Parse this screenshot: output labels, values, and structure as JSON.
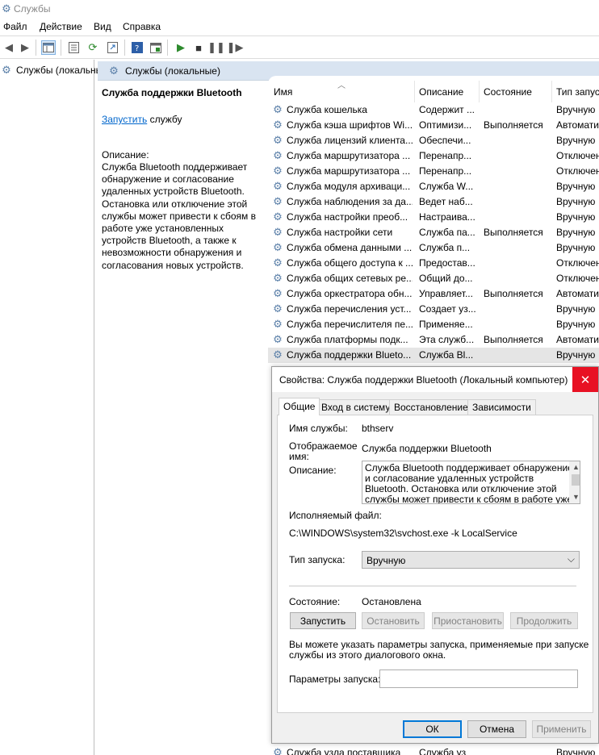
{
  "window": {
    "title": "Службы"
  },
  "menu": [
    "Файл",
    "Действие",
    "Вид",
    "Справка"
  ],
  "tree": {
    "item": "Службы (локальные)"
  },
  "pane": {
    "header": "Службы (локальные)"
  },
  "detail": {
    "service_title": "Служба поддержки Bluetooth",
    "start_link": "Запустить",
    "start_suffix": " службу",
    "description_label": "Описание:",
    "description_text": "Служба Bluetooth поддерживает обнаружение и согласование удаленных устройств Bluetooth. Остановка или отключение этой службы может привести к сбоям в работе уже установленных устройств Bluetooth, а также к невозможности обнаружения и согласования новых устройств."
  },
  "list": {
    "columns": [
      "Имя",
      "Описание",
      "Состояние",
      "Тип запуску"
    ],
    "rows": [
      {
        "name": "Служба кошелька",
        "desc": "Содержит ...",
        "state": "",
        "start": "Вручную"
      },
      {
        "name": "Служба кэша шрифтов Wi...",
        "desc": "Оптимизи...",
        "state": "Выполняется",
        "start": "Автомати"
      },
      {
        "name": "Служба лицензий клиента...",
        "desc": "Обеспечи...",
        "state": "",
        "start": "Вручную"
      },
      {
        "name": "Служба маршрутизатора ...",
        "desc": "Перенапр...",
        "state": "",
        "start": "Отключен"
      },
      {
        "name": "Служба маршрутизатора ...",
        "desc": "Перенапр...",
        "state": "",
        "start": "Отключен"
      },
      {
        "name": "Служба модуля архиваци...",
        "desc": "Служба W...",
        "state": "",
        "start": "Вручную"
      },
      {
        "name": "Служба наблюдения за да...",
        "desc": "Ведет наб...",
        "state": "",
        "start": "Вручную"
      },
      {
        "name": "Служба настройки преоб...",
        "desc": "Настраива...",
        "state": "",
        "start": "Вручную"
      },
      {
        "name": "Служба настройки сети",
        "desc": "Служба па...",
        "state": "Выполняется",
        "start": "Вручную"
      },
      {
        "name": "Служба обмена данными ...",
        "desc": "Служба п...",
        "state": "",
        "start": "Вручную"
      },
      {
        "name": "Служба общего доступа к ...",
        "desc": "Предостав...",
        "state": "",
        "start": "Отключен"
      },
      {
        "name": "Служба общих сетевых ре...",
        "desc": "Общий до...",
        "state": "",
        "start": "Отключен"
      },
      {
        "name": "Служба оркестратора обн...",
        "desc": "Управляет...",
        "state": "Выполняется",
        "start": "Автомати"
      },
      {
        "name": "Служба перечисления уст...",
        "desc": "Создает уз...",
        "state": "",
        "start": "Вручную"
      },
      {
        "name": "Служба перечислителя пе...",
        "desc": "Применяе...",
        "state": "",
        "start": "Вручную"
      },
      {
        "name": "Служба платформы подк...",
        "desc": "Эта служб...",
        "state": "Выполняется",
        "start": "Автомати"
      },
      {
        "name": "Служба поддержки Blueto...",
        "desc": "Служба Bl...",
        "state": "",
        "start": "Вручную"
      }
    ],
    "bottom_row": {
      "name": "Служба узла поставщика",
      "desc": "Служба уз",
      "start": "Вручную"
    }
  },
  "dialog": {
    "title": "Свойства: Служба поддержки Bluetooth (Локальный компьютер)",
    "close": "✕",
    "tabs": [
      "Общие",
      "Вход в систему",
      "Восстановление",
      "Зависимости"
    ],
    "service_name_label": "Имя службы:",
    "service_name": "bthserv",
    "display_name_label_1": "Отображаемое",
    "display_name_label_2": "имя:",
    "display_name": "Служба поддержки Bluetooth",
    "description_label": "Описание:",
    "description": "Служба Bluetooth поддерживает обнаружение и согласование удаленных устройств Bluetooth. Остановка или отключение этой службы может привести к сбоям в работе уже установленных",
    "exe_label": "Исполняемый файл:",
    "exe_path": "C:\\WINDOWS\\system32\\svchost.exe -k LocalService",
    "startup_type_label": "Тип запуска:",
    "startup_type": "Вручную",
    "status_label": "Состояние:",
    "status": "Остановлена",
    "btn_start": "Запустить",
    "btn_stop": "Остановить",
    "btn_pause": "Приостановить",
    "btn_resume": "Продолжить",
    "hint_1": "Вы можете указать параметры запуска, применяемые при запуске",
    "hint_2": "службы из этого диалогового окна.",
    "params_label": "Параметры запуска:",
    "params_value": "",
    "ok": "ОК",
    "cancel": "Отмена",
    "apply": "Применить"
  }
}
